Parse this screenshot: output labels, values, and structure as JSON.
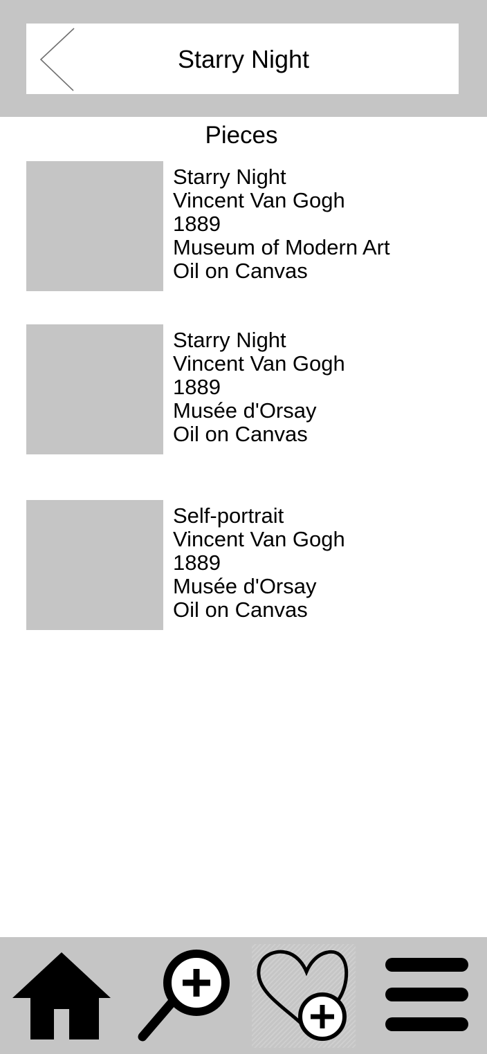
{
  "header": {
    "title": "Starry Night",
    "back_icon": "chevron-left-icon"
  },
  "section": {
    "title": "Pieces"
  },
  "pieces": [
    {
      "title": "Starry Night",
      "artist": "Vincent Van Gogh",
      "year": "1889",
      "location": "Museum of Modern Art",
      "medium": "Oil on Canvas"
    },
    {
      "title": "Starry Night",
      "artist": "Vincent Van Gogh",
      "year": "1889",
      "location": "Musée d'Orsay",
      "medium": "Oil on Canvas"
    },
    {
      "title": "Self-portrait",
      "artist": "Vincent Van Gogh",
      "year": "1889",
      "location": "Musée d'Orsay",
      "medium": "Oil on Canvas"
    }
  ],
  "nav": {
    "items": [
      {
        "icon": "home-icon"
      },
      {
        "icon": "zoom-in-icon"
      },
      {
        "icon": "heart-add-icon"
      },
      {
        "icon": "menu-icon"
      }
    ]
  },
  "colors": {
    "bar_gray": "#c5c5c5",
    "background": "#ffffff",
    "icon": "#000000"
  }
}
